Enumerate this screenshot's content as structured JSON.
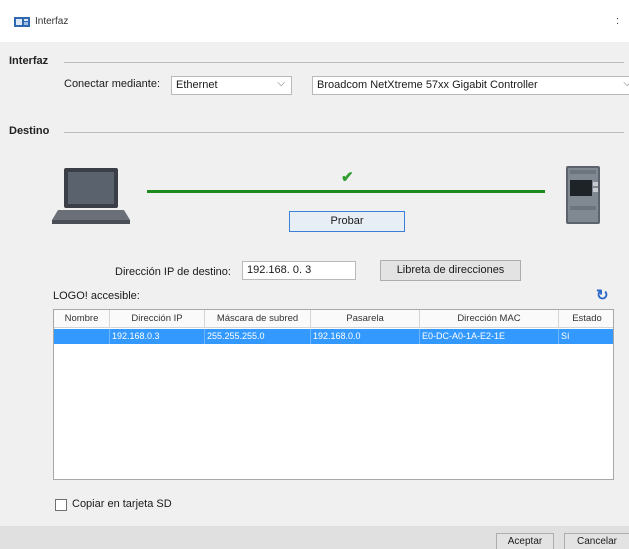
{
  "window": {
    "title": "Interfaz",
    "close_glyph": ":"
  },
  "interfaz": {
    "group_label": "Interfaz",
    "connect_label": "Conectar mediante:",
    "connect_value": "Ethernet",
    "adapter_value": "Broadcom NetXtreme 57xx Gigabit Controller"
  },
  "destino": {
    "group_label": "Destino",
    "status_glyph": "✔",
    "test_button": "Probar",
    "ip_label": "Dirección IP de destino:",
    "ip_value": "192.168. 0. 3",
    "address_book_button": "Libreta de direcciones",
    "accessible_label": "LOGO! accesible:",
    "refresh_glyph": "↻"
  },
  "table": {
    "headers": [
      "Nombre",
      "Dirección IP",
      "Máscara de subred",
      "Pasarela",
      "Dirección MAC",
      "Estado"
    ],
    "rows": [
      [
        "",
        "192.168.0.3",
        "255.255.255.0",
        "192.168.0.0",
        "E0-DC-A0-1A-E2-1E",
        "Sí"
      ]
    ]
  },
  "options": {
    "sd_copy_label": "Copiar en tarjeta SD",
    "sd_copy_checked": false
  },
  "footer": {
    "accept_button": "Aceptar",
    "cancel_button": "Cancelar"
  },
  "colors": {
    "selection": "#3399ff",
    "connection_line": "#1c8a1c",
    "check": "#2e9c2e",
    "refresh": "#2b66c9"
  }
}
